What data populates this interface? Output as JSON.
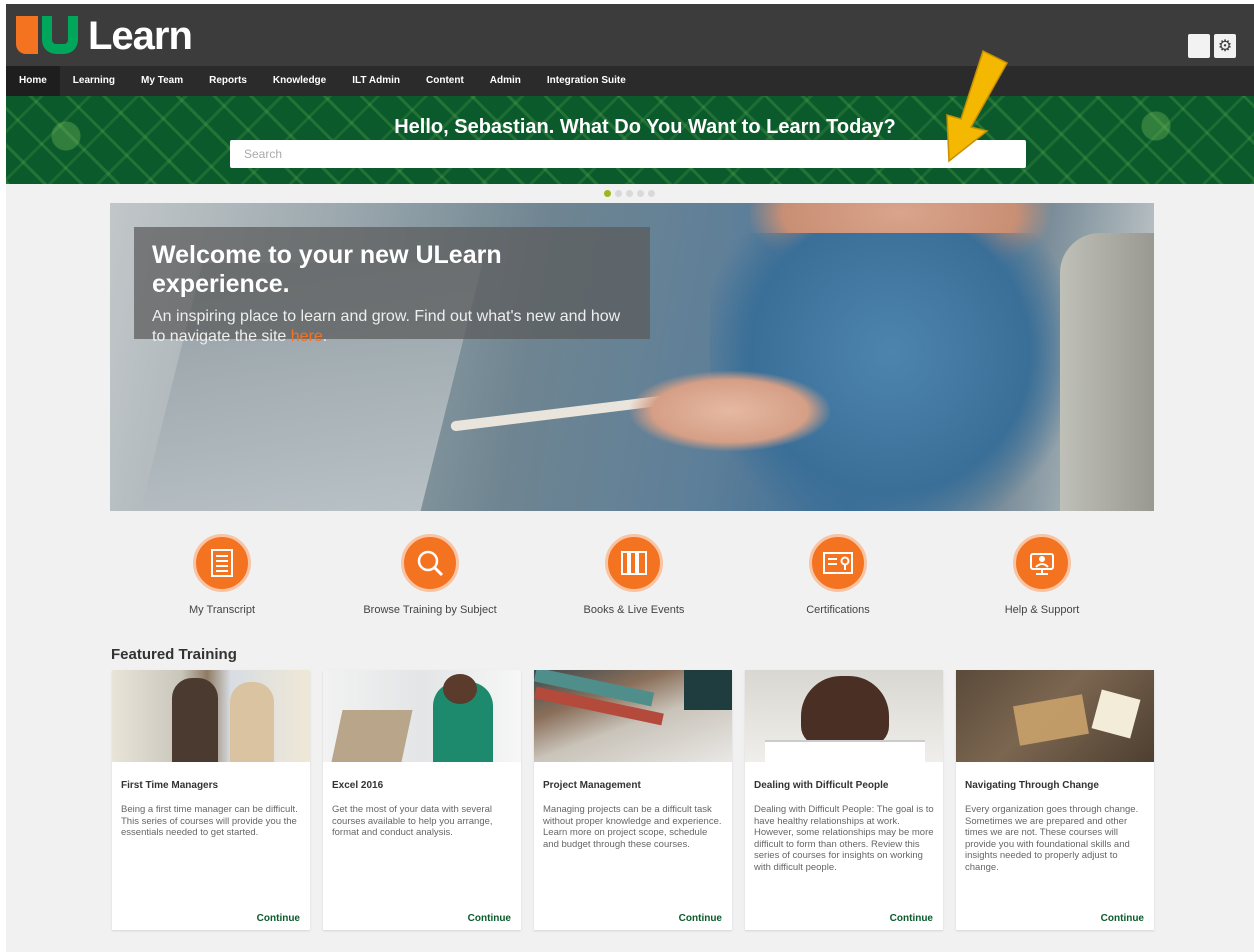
{
  "app": {
    "logo_text": "Learn"
  },
  "header": {
    "icons": [
      "blank-icon",
      "gear-icon"
    ],
    "gear_glyph": "⚙"
  },
  "nav": {
    "items": [
      {
        "label": "Home"
      },
      {
        "label": "Learning"
      },
      {
        "label": "My Team"
      },
      {
        "label": "Reports"
      },
      {
        "label": "Knowledge"
      },
      {
        "label": "ILT Admin"
      },
      {
        "label": "Content"
      },
      {
        "label": "Admin"
      },
      {
        "label": "Integration Suite"
      }
    ],
    "active": "Home"
  },
  "banner": {
    "title": "Hello, Sebastian. What Do You Want to Learn Today?"
  },
  "search": {
    "placeholder": "Search",
    "value": ""
  },
  "carousel": {
    "slides": 5,
    "active_slide": 1
  },
  "hero": {
    "title": "Welcome to your new ULearn experience.",
    "text": "An inspiring place to learn and grow. Find out what's new and how to navigate the site ",
    "link": "here",
    "text_end": "."
  },
  "quick_links": [
    {
      "label": "My Transcript",
      "icon": "transcript-icon"
    },
    {
      "label": "Browse Training by Subject",
      "icon": "search-icon"
    },
    {
      "label": "Books & Live Events",
      "icon": "books-icon"
    },
    {
      "label": "Certifications",
      "icon": "certificate-icon"
    },
    {
      "label": "Help & Support",
      "icon": "help-icon"
    }
  ],
  "featured": {
    "title": "Featured Training",
    "cards": [
      {
        "title": "First Time Managers",
        "text": "Being a first time manager can be difficult. This series of courses will provide you the essentials needed to get started.",
        "button": "Continue"
      },
      {
        "title": "Excel 2016",
        "text": "Get the most of your data with several courses available to help you arrange, format and conduct analysis.",
        "button": "Continue"
      },
      {
        "title": "Project Management",
        "text": "Managing projects can be a difficult task without proper knowledge and experience. Learn more on project scope, schedule and budget through these courses.",
        "button": "Continue"
      },
      {
        "title": "Dealing with Difficult People",
        "text": "Dealing with Difficult People: The goal is to have healthy relationships at work. However, some relationships may be more difficult to form than others. Review this series of courses for insights on working with difficult people.",
        "button": "Continue"
      },
      {
        "title": "Navigating Through Change",
        "text": "Every organization goes through change. Sometimes we are prepared and other times we are not. These courses will provide you with foundational skills and insights needed to properly adjust to change.",
        "button": "Continue"
      }
    ]
  },
  "colors": {
    "brand_orange": "#f47321",
    "brand_green": "#0b5a2c",
    "annotation_arrow": "#f5b800"
  }
}
